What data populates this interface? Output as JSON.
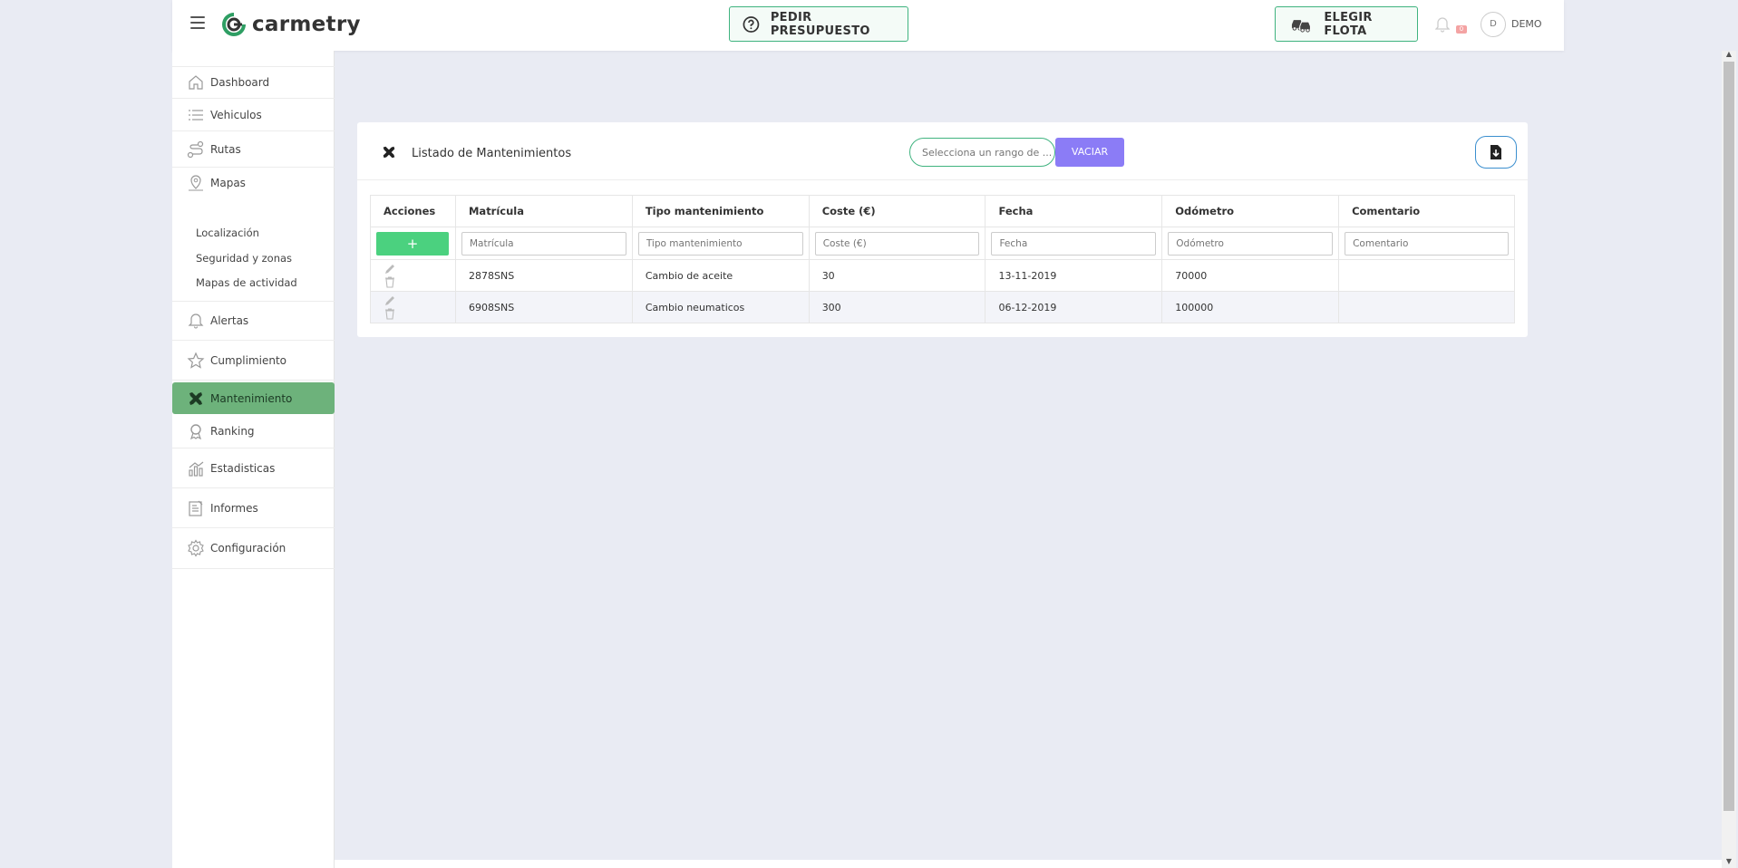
{
  "header": {
    "brand": "carmetry",
    "presupuesto_label": "PEDIR PRESUPUESTO",
    "flota_label": "ELEGIR FLOTA",
    "notification_count": "0",
    "user_initial": "D",
    "user_name": "DEMO",
    "brand_color": "#2e9e63"
  },
  "sidebar": {
    "items": [
      {
        "label": "Dashboard",
        "icon": "home-icon"
      },
      {
        "label": "Vehiculos",
        "icon": "list-icon"
      },
      {
        "label": "Rutas",
        "icon": "route-icon"
      },
      {
        "label": "Mapas",
        "icon": "map-pin-icon"
      },
      {
        "label": "Alertas",
        "icon": "bell-icon"
      },
      {
        "label": "Cumplimiento",
        "icon": "star-icon"
      },
      {
        "label": "Mantenimiento",
        "icon": "wrench-icon"
      },
      {
        "label": "Ranking",
        "icon": "award-icon"
      },
      {
        "label": "Estadisticas",
        "icon": "bar-chart-icon"
      },
      {
        "label": "Informes",
        "icon": "report-icon"
      },
      {
        "label": "Configuración",
        "icon": "gear-icon"
      }
    ],
    "sub_items": [
      "Localización",
      "Seguridad y zonas",
      "Mapas de actividad"
    ],
    "active": "Mantenimiento"
  },
  "card": {
    "title": "Listado de Mantenimientos",
    "date_placeholder": "Selecciona un rango de ...",
    "clear_label": "VACIAR"
  },
  "table": {
    "columns": [
      "Acciones",
      "Matrícula",
      "Tipo mantenimiento",
      "Coste (€)",
      "Fecha",
      "Odómetro",
      "Comentario"
    ],
    "filter_placeholders": [
      "Matrícula",
      "Tipo mantenimiento",
      "Coste (€)",
      "Fecha",
      "Odómetro",
      "Comentario"
    ],
    "add_label": "+",
    "rows": [
      {
        "matricula": "2878SNS",
        "tipo": "Cambio de aceite",
        "coste": "30",
        "fecha": "13-11-2019",
        "odometro": "70000",
        "comentario": ""
      },
      {
        "matricula": "6908SNS",
        "tipo": "Cambio neumaticos",
        "coste": "300",
        "fecha": "06-12-2019",
        "odometro": "100000",
        "comentario": ""
      }
    ]
  }
}
